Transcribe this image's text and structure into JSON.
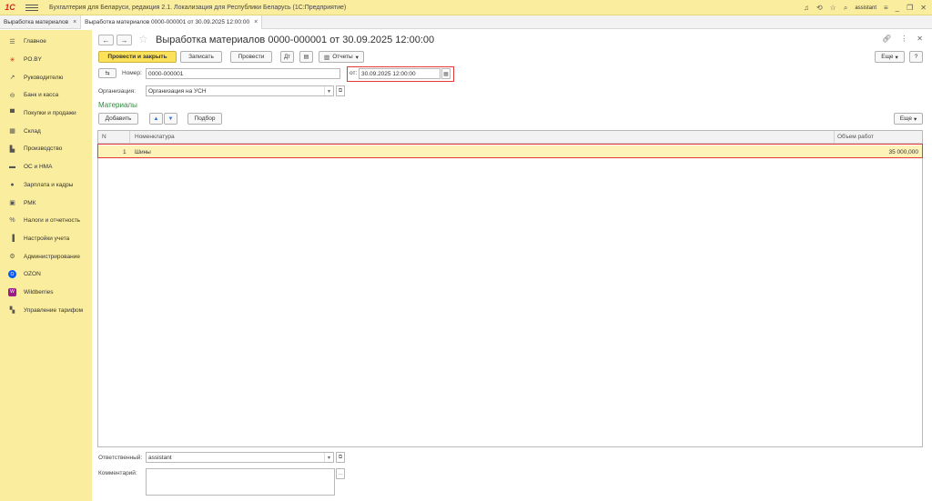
{
  "app": {
    "logo": "1С",
    "title": "Бухгалтерия для Беларуси, редакция 2.1. Локализация для Республики Беларусь   (1С:Предприятие)",
    "user": "assistant"
  },
  "tabs": [
    {
      "label": "Выработка материалов"
    },
    {
      "label": "Выработка материалов 0000-000001 от 30.09.2025 12:00:00"
    }
  ],
  "sidebar": {
    "items": [
      {
        "label": "Главное",
        "icon": "menu-icon"
      },
      {
        "label": "PO.BY",
        "icon": "po-by-icon"
      },
      {
        "label": "Руководителю",
        "icon": "trend-icon"
      },
      {
        "label": "Банк и касса",
        "icon": "bank-icon"
      },
      {
        "label": "Покупки и продажи",
        "icon": "cart-icon"
      },
      {
        "label": "Склад",
        "icon": "warehouse-icon"
      },
      {
        "label": "Производство",
        "icon": "factory-icon"
      },
      {
        "label": "ОС и НМА",
        "icon": "truck-icon"
      },
      {
        "label": "Зарплата и кадры",
        "icon": "person-icon"
      },
      {
        "label": "РМК",
        "icon": "register-icon"
      },
      {
        "label": "Налоги и отчетность",
        "icon": "percent-icon"
      },
      {
        "label": "Настройки учета",
        "icon": "book-icon"
      },
      {
        "label": "Администрирование",
        "icon": "gear-icon"
      },
      {
        "label": "OZON",
        "icon": "ozon-icon"
      },
      {
        "label": "Wildberries",
        "icon": "wildberries-icon"
      },
      {
        "label": "Управление тарифом",
        "icon": "grid-icon"
      }
    ]
  },
  "document": {
    "title": "Выработка материалов 0000-000001 от 30.09.2025 12:00:00"
  },
  "toolbar": {
    "post_close": "Провести и закрыть",
    "save": "Записать",
    "post": "Провести",
    "reports": "Отчеты",
    "more": "Еще"
  },
  "form": {
    "number_label": "Номер:",
    "number_value": "0000-000001",
    "date_label": "от:",
    "date_value": "30.09.2025 12:00:00",
    "org_label": "Организация:",
    "org_value": "Организация на УСН",
    "responsible_label": "Ответственный:",
    "responsible_value": "assistant",
    "comment_label": "Комментарий:"
  },
  "materials": {
    "title": "Материалы",
    "add": "Добавить",
    "pick": "Подбор",
    "more": "Еще",
    "columns": {
      "n": "N",
      "name": "Номенклатура",
      "volume": "Объем работ"
    },
    "rows": [
      {
        "n": "1",
        "name": "Шины",
        "volume": "35 000,000"
      }
    ]
  }
}
